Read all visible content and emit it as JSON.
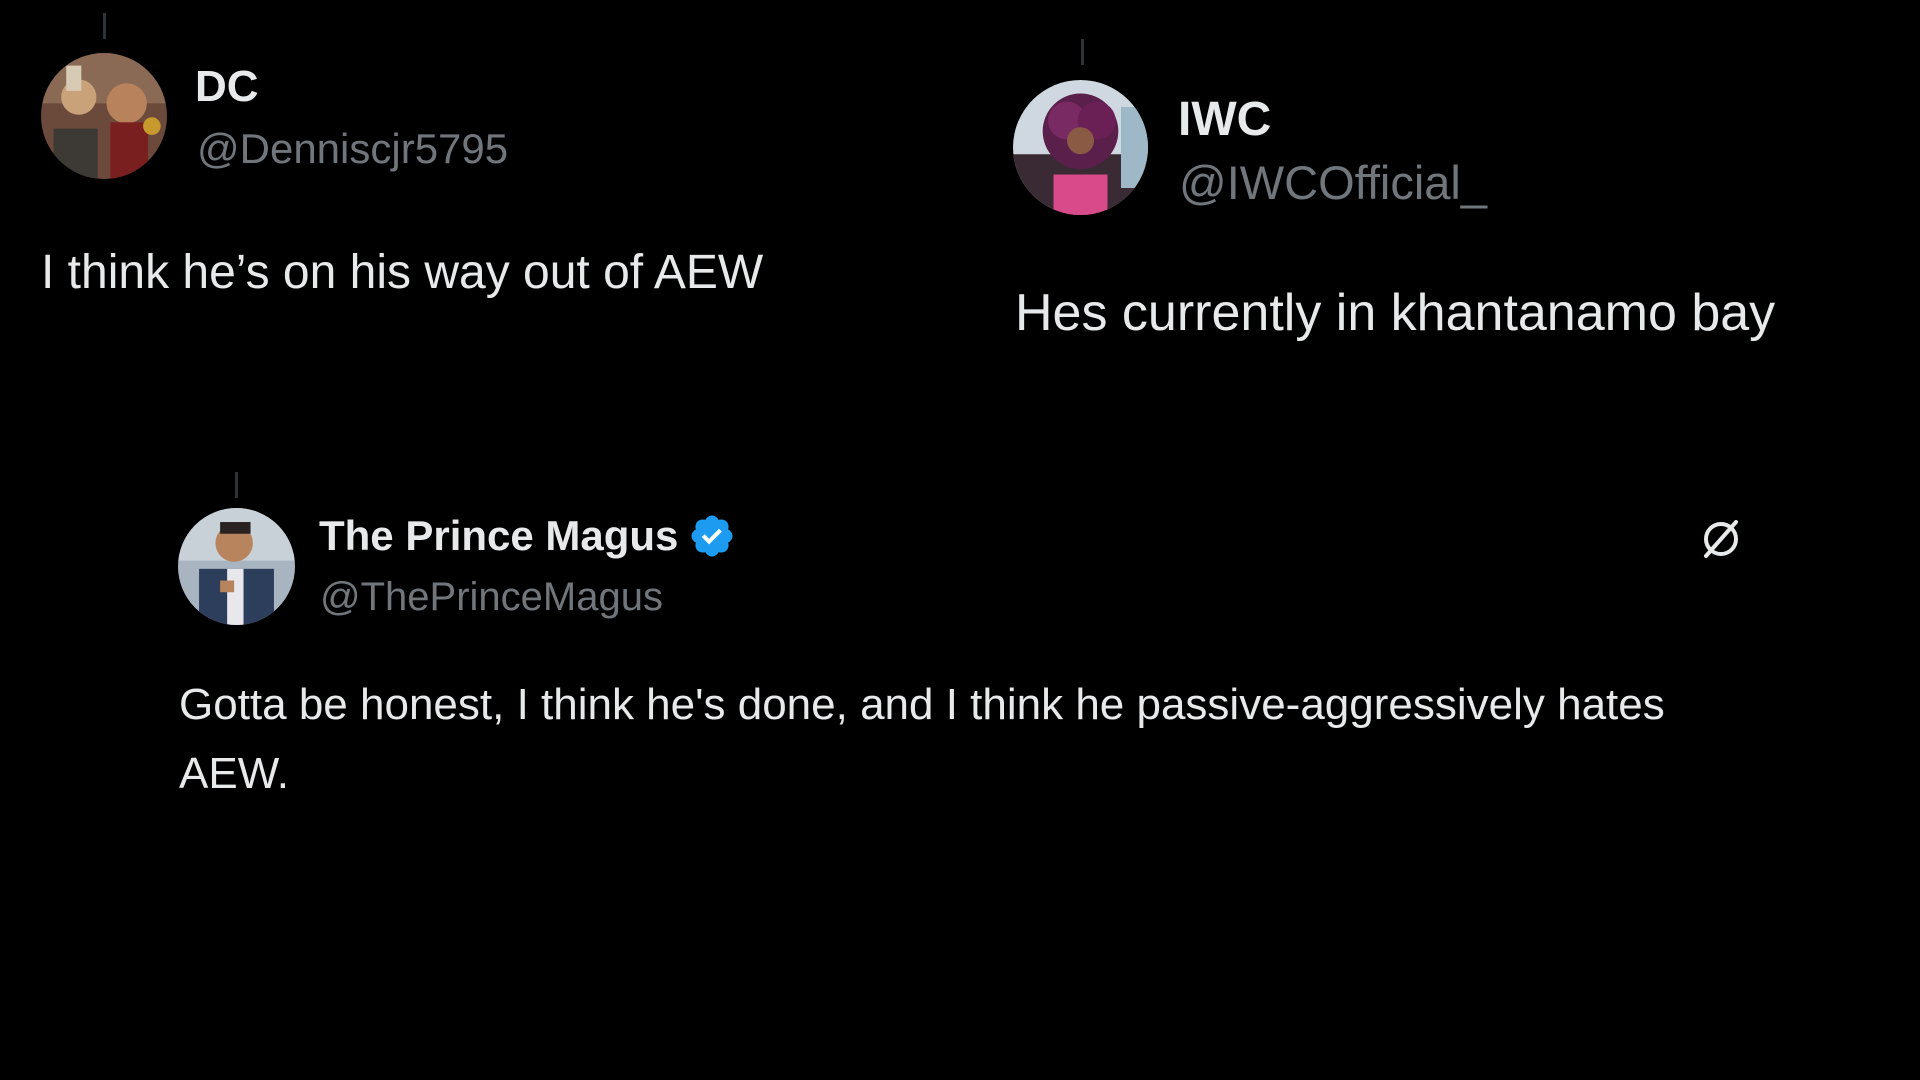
{
  "tweets": [
    {
      "name": "DC",
      "handle": "@Denniscjr5795",
      "text": "I think he’s on his way out of AEW"
    },
    {
      "name": "IWC",
      "handle": "@IWCOfficial_",
      "text": "Hes currently in khantanamo bay"
    },
    {
      "name": "The Prince Magus",
      "handle": "@ThePrinceMagus",
      "text": "Gotta be honest, I think he's done, and I think he passive-aggressively hates AEW.",
      "verified": true
    }
  ],
  "colors": {
    "background": "#000000",
    "primary_text": "#e7e9ea",
    "secondary_text": "#71767b",
    "verified_blue": "#1d9bf0"
  },
  "icons": {
    "verified": "verified-badge-icon",
    "grok": "grok-icon"
  }
}
